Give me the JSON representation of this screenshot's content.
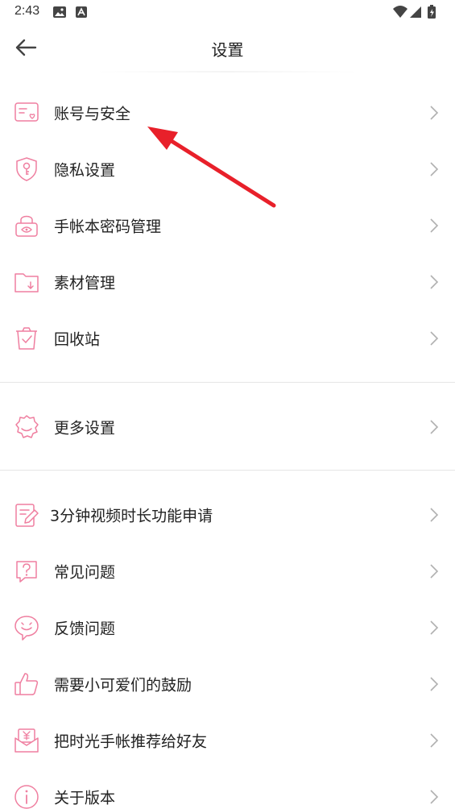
{
  "status_bar": {
    "time": "2:43",
    "icons": [
      "image-icon",
      "a-icon",
      "wifi-icon",
      "signal-icon",
      "battery-icon"
    ]
  },
  "header": {
    "title": "设置",
    "back_icon": "arrow-left-icon"
  },
  "groups": [
    {
      "items": [
        {
          "label": "账号与安全",
          "icon": "account-card-icon"
        },
        {
          "label": "隐私设置",
          "icon": "shield-key-icon"
        },
        {
          "label": "手帐本密码管理",
          "icon": "lock-icon"
        },
        {
          "label": "素材管理",
          "icon": "folder-download-icon"
        },
        {
          "label": "回收站",
          "icon": "trash-icon"
        }
      ]
    },
    {
      "items": [
        {
          "label": "更多设置",
          "icon": "gear-icon"
        }
      ]
    },
    {
      "items": [
        {
          "label": "3分钟视频时长功能申请",
          "icon": "edit-document-icon"
        },
        {
          "label": "常见问题",
          "icon": "question-icon"
        },
        {
          "label": "反馈问题",
          "icon": "smile-bubble-icon"
        },
        {
          "label": "需要小可爱们的鼓励",
          "icon": "thumbs-up-icon"
        },
        {
          "label": "把时光手帐推荐给好友",
          "icon": "red-envelope-icon"
        },
        {
          "label": "关于版本",
          "icon": "info-icon"
        }
      ]
    }
  ],
  "colors": {
    "accent": "#ef7fa0",
    "chevron": "#b0b0b0",
    "annotation_arrow": "#e8202a"
  }
}
